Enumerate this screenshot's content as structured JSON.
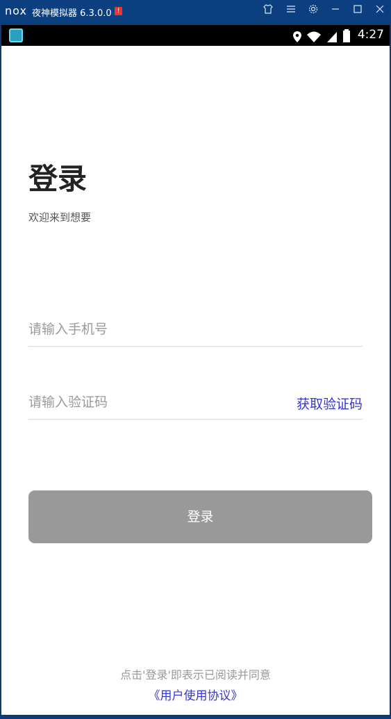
{
  "window": {
    "logo": "nox",
    "title": "夜神模拟器 6.3.0.0",
    "alert_badge": "!",
    "controls": [
      "shirt-icon",
      "menu-icon",
      "gear-icon",
      "minimize-icon",
      "maximize-icon",
      "close-icon"
    ]
  },
  "statusbar": {
    "time": "4:27",
    "icons": [
      "location-icon",
      "wifi-icon",
      "signal-icon",
      "battery-icon"
    ]
  },
  "login": {
    "title": "登录",
    "subtitle": "欢迎来到想要",
    "phone_placeholder": "请输入手机号",
    "code_placeholder": "请输入验证码",
    "get_code_label": "获取验证码",
    "button_label": "登录",
    "agreement_text": "点击'登录'即表示已阅读并同意",
    "agreement_link": "《用户使用协议》"
  },
  "colors": {
    "accent": "#3535cf",
    "button_disabled": "#999999",
    "titlebar": "#0c3f80"
  }
}
